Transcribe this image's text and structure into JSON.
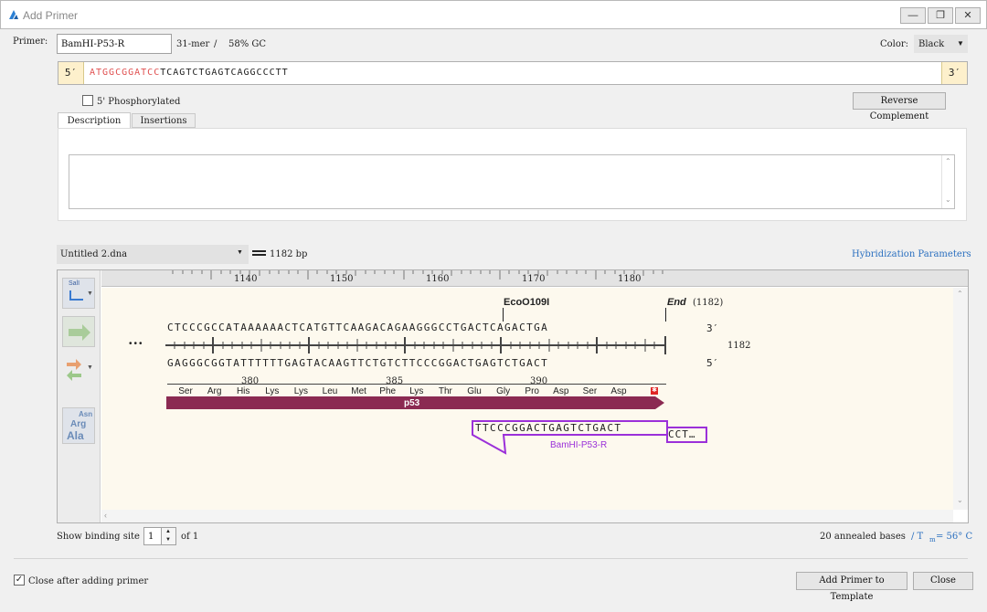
{
  "window": {
    "title": "Add Primer"
  },
  "primer": {
    "label": "Primer:",
    "name": "BamHI-P53-R",
    "stats": "31-mer",
    "sep": "/",
    "gc": "58% GC",
    "color_label": "Color:",
    "color_value": "Black",
    "five_prime": "5′",
    "three_prime": "3′",
    "seq_tail": "ATGGCGGATCC",
    "seq_body": "TCAGTCTGAGTCAGGCCCTT",
    "tail_color": "#e05050",
    "phosphorylated_label": "5' Phosphorylated",
    "reverse_complement_label": "Reverse Complement"
  },
  "tabs": [
    {
      "label": "Description"
    },
    {
      "label": "Insertions"
    }
  ],
  "template": {
    "file": "Untitled 2.dna",
    "length": "1182 bp",
    "hybridization_link": "Hybridization Parameters"
  },
  "ruler": {
    "ticks": [
      "1140",
      "1150",
      "1160",
      "1170",
      "1180"
    ]
  },
  "map": {
    "ellipsis": "•••",
    "top_strand": "CTCCCGCCATAAAAAACTCATGTTCAAGACAGAAGGGCCTGACTCAGACTGA",
    "bottom_strand": "GAGGGCGGTATTTTTTGAGTACAAGTTCTGTCTTCCCGGACTGAGTCTGACT",
    "top_end": "3′",
    "bottom_end": "5′",
    "end_position": "1182",
    "enzyme": "EcoO109I",
    "end_label": "End",
    "end_pos_paren": "(1182)",
    "aa_numbers": [
      "380",
      "385",
      "390"
    ],
    "amino_acids": [
      "Ser",
      "Arg",
      "His",
      "Lys",
      "Lys",
      "Leu",
      "Met",
      "Phe",
      "Lys",
      "Thr",
      "Glu",
      "Gly",
      "Pro",
      "Asp",
      "Ser",
      "Asp"
    ],
    "feature_label": "p53",
    "feature_color": "#8b2a52",
    "primer_seq": "TTCCCGGACTGAGTCTGACT",
    "primer_overhang": "CCT…",
    "primer_name": "BamHI-P53-R",
    "primer_color": "#9b30d9"
  },
  "tools": {
    "sali_label": "SalI",
    "aa_labels": [
      "Asn",
      "Arg",
      "Ala"
    ]
  },
  "binding": {
    "show_label": "Show binding site",
    "site": "1",
    "of_label": "of 1",
    "annealed": "20 annealed bases",
    "tm_prefix": "/ T",
    "tm_sub": "m",
    "tm_value": "= 56° C"
  },
  "footer": {
    "close_after": "Close after adding primer",
    "add_button": "Add Primer to Template",
    "close_button": "Close"
  }
}
